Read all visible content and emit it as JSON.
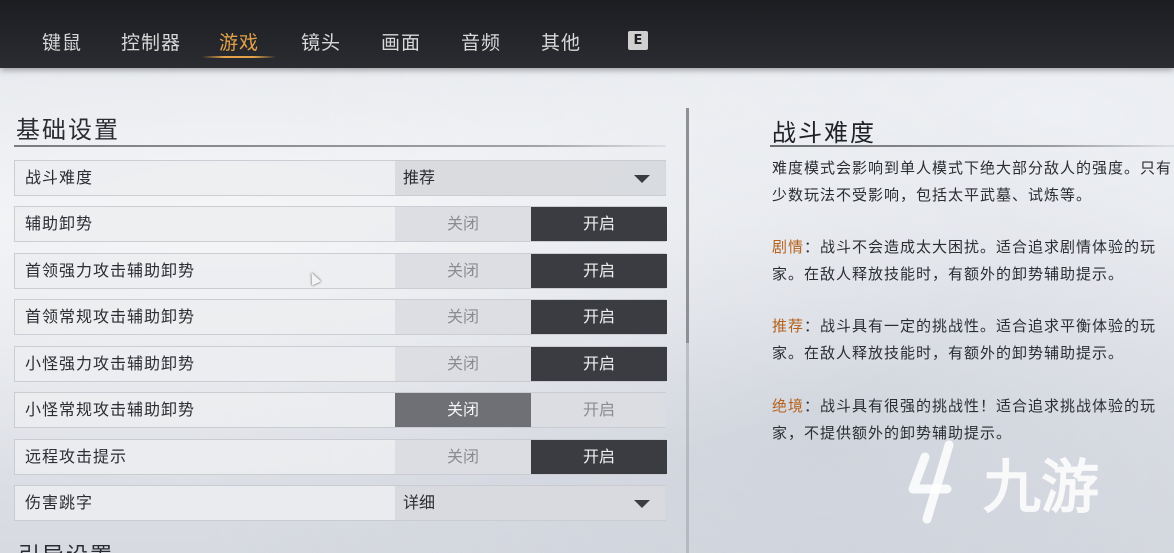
{
  "nav": {
    "tabs": [
      {
        "label": "键鼠"
      },
      {
        "label": "控制器"
      },
      {
        "label": "游戏",
        "active": true
      },
      {
        "label": "镜头"
      },
      {
        "label": "画面"
      },
      {
        "label": "音频"
      },
      {
        "label": "其他"
      }
    ],
    "key_hint": "E",
    "accent_color": "#e3a24a"
  },
  "settings": {
    "section_title": "基础设置",
    "rows": [
      {
        "label": "战斗难度",
        "type": "dropdown",
        "value": "推荐"
      },
      {
        "label": "辅助卸势",
        "type": "toggle",
        "off": "关闭",
        "on": "开启",
        "selected": "on"
      },
      {
        "label": "首领强力攻击辅助卸势",
        "type": "toggle",
        "off": "关闭",
        "on": "开启",
        "selected": "on"
      },
      {
        "label": "首领常规攻击辅助卸势",
        "type": "toggle",
        "off": "关闭",
        "on": "开启",
        "selected": "on"
      },
      {
        "label": "小怪强力攻击辅助卸势",
        "type": "toggle",
        "off": "关闭",
        "on": "开启",
        "selected": "on"
      },
      {
        "label": "小怪常规攻击辅助卸势",
        "type": "toggle",
        "off": "关闭",
        "on": "开启",
        "selected": "off"
      },
      {
        "label": "远程攻击提示",
        "type": "toggle",
        "off": "关闭",
        "on": "开启",
        "selected": "on"
      },
      {
        "label": "伤害跳字",
        "type": "dropdown",
        "value": "详细"
      }
    ],
    "next_section_title": "引导设置"
  },
  "info": {
    "title": "战斗难度",
    "intro": "难度模式会影响到单人模式下绝大部分敌人的强度。只有少数玩法不受影响，包括太平武墓、试炼等。",
    "modes": [
      {
        "name": "剧情",
        "desc": "：战斗不会造成太大困扰。适合追求剧情体验的玩家。在敌人释放技能时，有额外的卸势辅助提示。"
      },
      {
        "name": "推荐",
        "desc": "：战斗具有一定的挑战性。适合追求平衡体验的玩家。在敌人释放技能时，有额外的卸势辅助提示。"
      },
      {
        "name": "绝境",
        "desc": "：战斗具有很强的挑战性！适合追求挑战体验的玩家，不提供额外的卸势辅助提示。"
      }
    ],
    "highlight_color": "#b5621c"
  },
  "watermark": {
    "text": "九游",
    "icon": "jiuyou-logo-icon"
  }
}
